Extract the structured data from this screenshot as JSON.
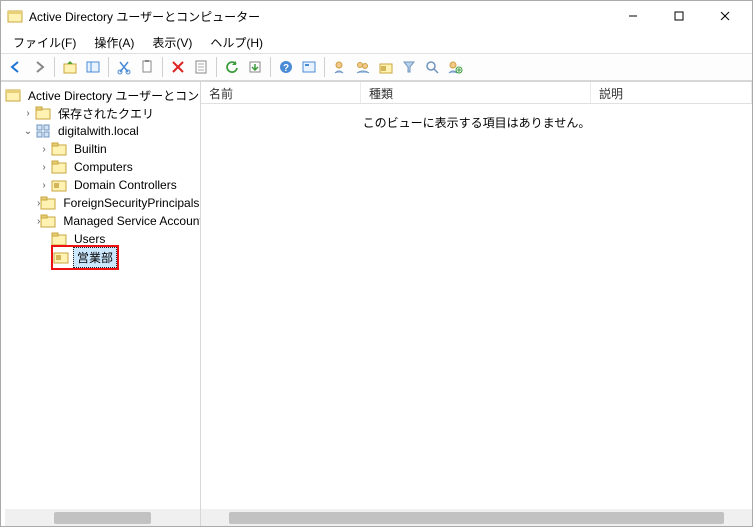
{
  "window": {
    "title": "Active Directory ユーザーとコンピューター"
  },
  "menu": {
    "file": "ファイル(F)",
    "action": "操作(A)",
    "view": "表示(V)",
    "help": "ヘルプ(H)"
  },
  "tree": {
    "root": "Active Directory ユーザーとコンピューター",
    "savedQueries": "保存されたクエリ",
    "domain": "digitalwith.local",
    "children": {
      "builtin": "Builtin",
      "computers": "Computers",
      "domainControllers": "Domain Controllers",
      "fsp": "ForeignSecurityPrincipals",
      "msa": "Managed Service Accounts",
      "users": "Users",
      "eigyobu": "営業部"
    }
  },
  "columns": {
    "name": "名前",
    "type": "種類",
    "description": "説明"
  },
  "empty": "このビューに表示する項目はありません。"
}
